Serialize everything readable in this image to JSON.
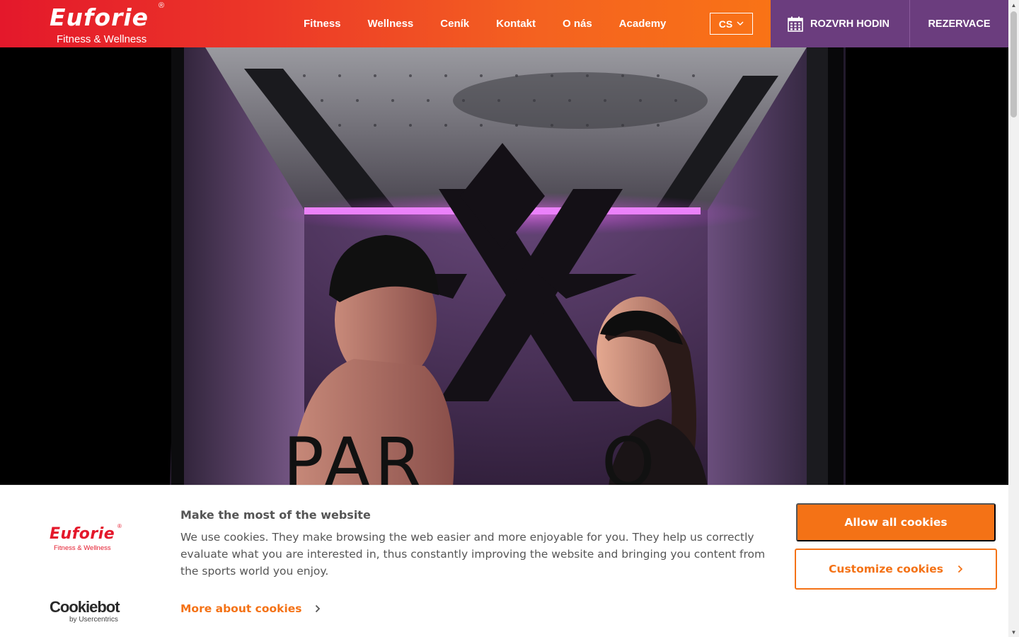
{
  "brand": {
    "name": "Euforie",
    "registered": "®",
    "tagline": "Fitness & Wellness"
  },
  "nav": {
    "items": [
      {
        "label": "Fitness"
      },
      {
        "label": "Wellness"
      },
      {
        "label": "Ceník"
      },
      {
        "label": "Kontakt"
      },
      {
        "label": "O nás"
      },
      {
        "label": "Academy"
      }
    ],
    "language": "CS"
  },
  "header_actions": {
    "schedule_label": "ROZVRH HODIN",
    "reserve_label": "REZERVACE"
  },
  "hero": {
    "sign_text": "PAR",
    "sign_text_right": "O"
  },
  "cookie_banner": {
    "title": "Make the most of the website",
    "body": "We use cookies. They make browsing the web easier and more enjoyable for you. They help us correctly evaluate what you are interested in, thus constantly improving the website and bringing you content from the sports world you enjoy.",
    "more_link": "More about cookies",
    "allow_all": "Allow all cookies",
    "customize": "Customize cookies",
    "provider_name": "Cookiebot",
    "provider_sub": "by Usercentrics"
  },
  "colors": {
    "brand_red": "#e4182b",
    "brand_orange": "#f47216",
    "header_purple": "#6b3d7e",
    "neon_purple": "#c03ae0"
  },
  "icons": {
    "calendar": "calendar-icon",
    "chevron": "chevron-right-icon",
    "dropdown": "chevron-down-icon"
  }
}
